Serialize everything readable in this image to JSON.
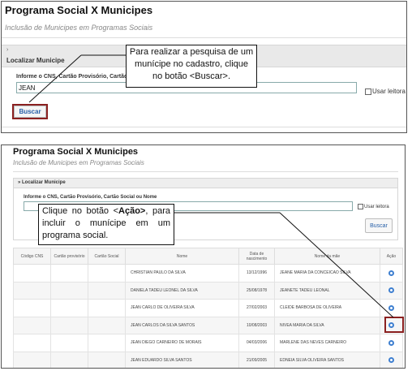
{
  "panel1": {
    "title": "Programa Social X Municipes",
    "subtitle": "Inclusão de Municipes em Programas Sociais",
    "section_chevron": "›",
    "section_label": "Localizar Municipe",
    "field_label": "Informe o CNS, Cartão Provisório, Cartão S",
    "search_value": "JEAN",
    "checkbox_label": "Usar leitora",
    "buscar_label": "Buscar",
    "callout": "Para realizar a pesquisa de um munícipe no cadastro, clique no botão <Buscar>."
  },
  "panel2": {
    "title": "Programa Social X Municipes",
    "subtitle": "Inclusão de Municipes em Programas Sociais",
    "section_label": "» Localizar Municipe",
    "field_label": "Informe o CNS, Cartão Provisório, Cartão Social ou Nome",
    "search_value": "",
    "checkbox_label": "Usar leitora",
    "buscar_label": "Buscar",
    "callout_prefix": "Clique no botão <",
    "callout_bold": "Ação>",
    "callout_suffix": ", para incluir o munícipe em um programa social.",
    "table": {
      "headers": [
        "Código CNS",
        "Cartão provisório",
        "Cartão Social",
        "Nome",
        "Data de nascimento",
        "Nome da mãe",
        "Ação"
      ],
      "rows": [
        {
          "cns": "",
          "provisorio": "",
          "social": "",
          "nome": "CHRISTIAN PAULO DA SILVA",
          "nascimento": "13/12/1996",
          "mae": "JEANE MARIA DA CONCEICAO SILVA"
        },
        {
          "cns": "",
          "provisorio": "",
          "social": "",
          "nome": "DANIELA TADEU LEONEL DA SILVA",
          "nascimento": "25/08/1978",
          "mae": "JEANETE TADEU LEONAL"
        },
        {
          "cns": "",
          "provisorio": "",
          "social": "",
          "nome": "JEAN CARLO DE OLIVEIRA SILVA",
          "nascimento": "27/02/2003",
          "mae": "CLEIDE BARBOSA DE OLIVEIRA"
        },
        {
          "cns": "",
          "provisorio": "",
          "social": "",
          "nome": "JEAN CARLOS DA SILVA SANTOS",
          "nascimento": "10/08/2003",
          "mae": "NIVEA MARIA DA SILVA"
        },
        {
          "cns": "",
          "provisorio": "",
          "social": "",
          "nome": "JEAN DIEGO CARNEIRO DE MORAIS",
          "nascimento": "04/03/2006",
          "mae": "MARLENE DAS NEVES CARNEIRO"
        },
        {
          "cns": "",
          "provisorio": "",
          "social": "",
          "nome": "JEAN EDUARDO SILVA SANTOS",
          "nascimento": "21/09/2005",
          "mae": "EDNEIA SILVA OLIVEIRA SANTOS"
        }
      ]
    }
  },
  "colors": {
    "highlight_border": "#8b2020",
    "link_blue": "#2860a8",
    "action_icon": "#3e7fd0"
  }
}
